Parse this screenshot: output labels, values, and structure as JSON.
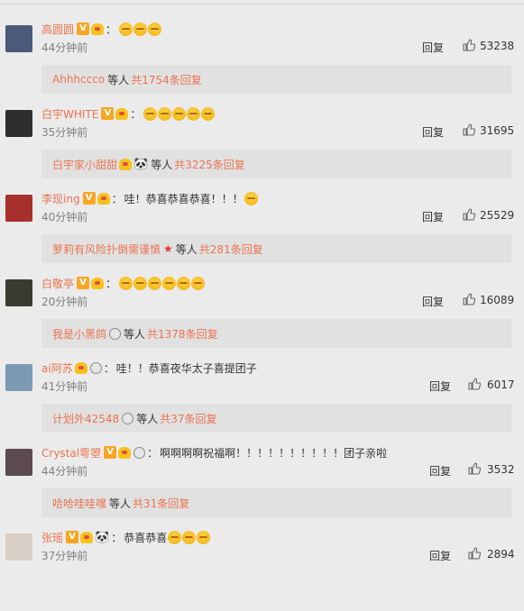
{
  "comments": [
    {
      "user": "高圆圆",
      "text": "",
      "emojis": 3,
      "badges": [
        "v",
        "crown"
      ],
      "time": "44分钟前",
      "reply": "回复",
      "likes": "53238",
      "sub": {
        "name": "Ahhhccco",
        "extra": [],
        "mid": "等人",
        "count": "共1754条回复"
      },
      "avatar_color": "#4a5a7a"
    },
    {
      "user": "白宇WHITE",
      "text": "",
      "emojis": 5,
      "badges": [
        "v",
        "crown"
      ],
      "time": "35分钟前",
      "reply": "回复",
      "likes": "31695",
      "sub": {
        "name": "白宇家小甜甜",
        "extra": [
          "crown",
          "panda"
        ],
        "mid": "等人",
        "count": "共3225条回复"
      },
      "avatar_color": "#2e2e2e"
    },
    {
      "user": "李现ing",
      "text": "哇！恭喜恭喜恭喜！！！",
      "emojis": 1,
      "badges": [
        "v",
        "crown"
      ],
      "time": "40分钟前",
      "reply": "回复",
      "likes": "25529",
      "sub": {
        "name": "萝莉有风险扑倒需谨慎",
        "extra": [
          "star"
        ],
        "mid": "等人",
        "count": "共281条回复"
      },
      "avatar_color": "#a8302c"
    },
    {
      "user": "白敬亭",
      "text": "",
      "emojis": 6,
      "badges": [
        "v",
        "crown"
      ],
      "time": "20分钟前",
      "reply": "回复",
      "likes": "16089",
      "sub": {
        "name": "我是小黑鸽",
        "extra": [
          "medal"
        ],
        "mid": "等人",
        "count": "共1378条回复"
      },
      "avatar_color": "#3b3a30"
    },
    {
      "user": "ai阿苏",
      "text": "哇！！恭喜夜华太子喜提团子",
      "emojis": 0,
      "badges": [
        "crown",
        "medal"
      ],
      "time": "41分钟前",
      "reply": "回复",
      "likes": "6017",
      "sub": {
        "name": "计划外42548",
        "extra": [
          "medal"
        ],
        "mid": "等人",
        "count": "共37条回复"
      },
      "avatar_color": "#7d9ab5"
    },
    {
      "user": "Crystal雩曌",
      "text": "啊啊啊啊祝福啊！！！！！！！！！！团子亲啦",
      "emojis": 0,
      "badges": [
        "v",
        "crown",
        "medal"
      ],
      "time": "44分钟前",
      "reply": "回复",
      "likes": "3532",
      "sub": {
        "name": "哈哈哇哇嘿",
        "extra": [],
        "mid": "等人",
        "count": "共31条回复"
      },
      "avatar_color": "#5b4a52"
    },
    {
      "user": "张瑶",
      "text": "恭喜恭喜",
      "emojis": 3,
      "badges": [
        "v",
        "crown",
        "panda"
      ],
      "time": "37分钟前",
      "reply": "回复",
      "likes": "2894",
      "sub": null,
      "avatar_color": "#d9cfc7"
    }
  ]
}
